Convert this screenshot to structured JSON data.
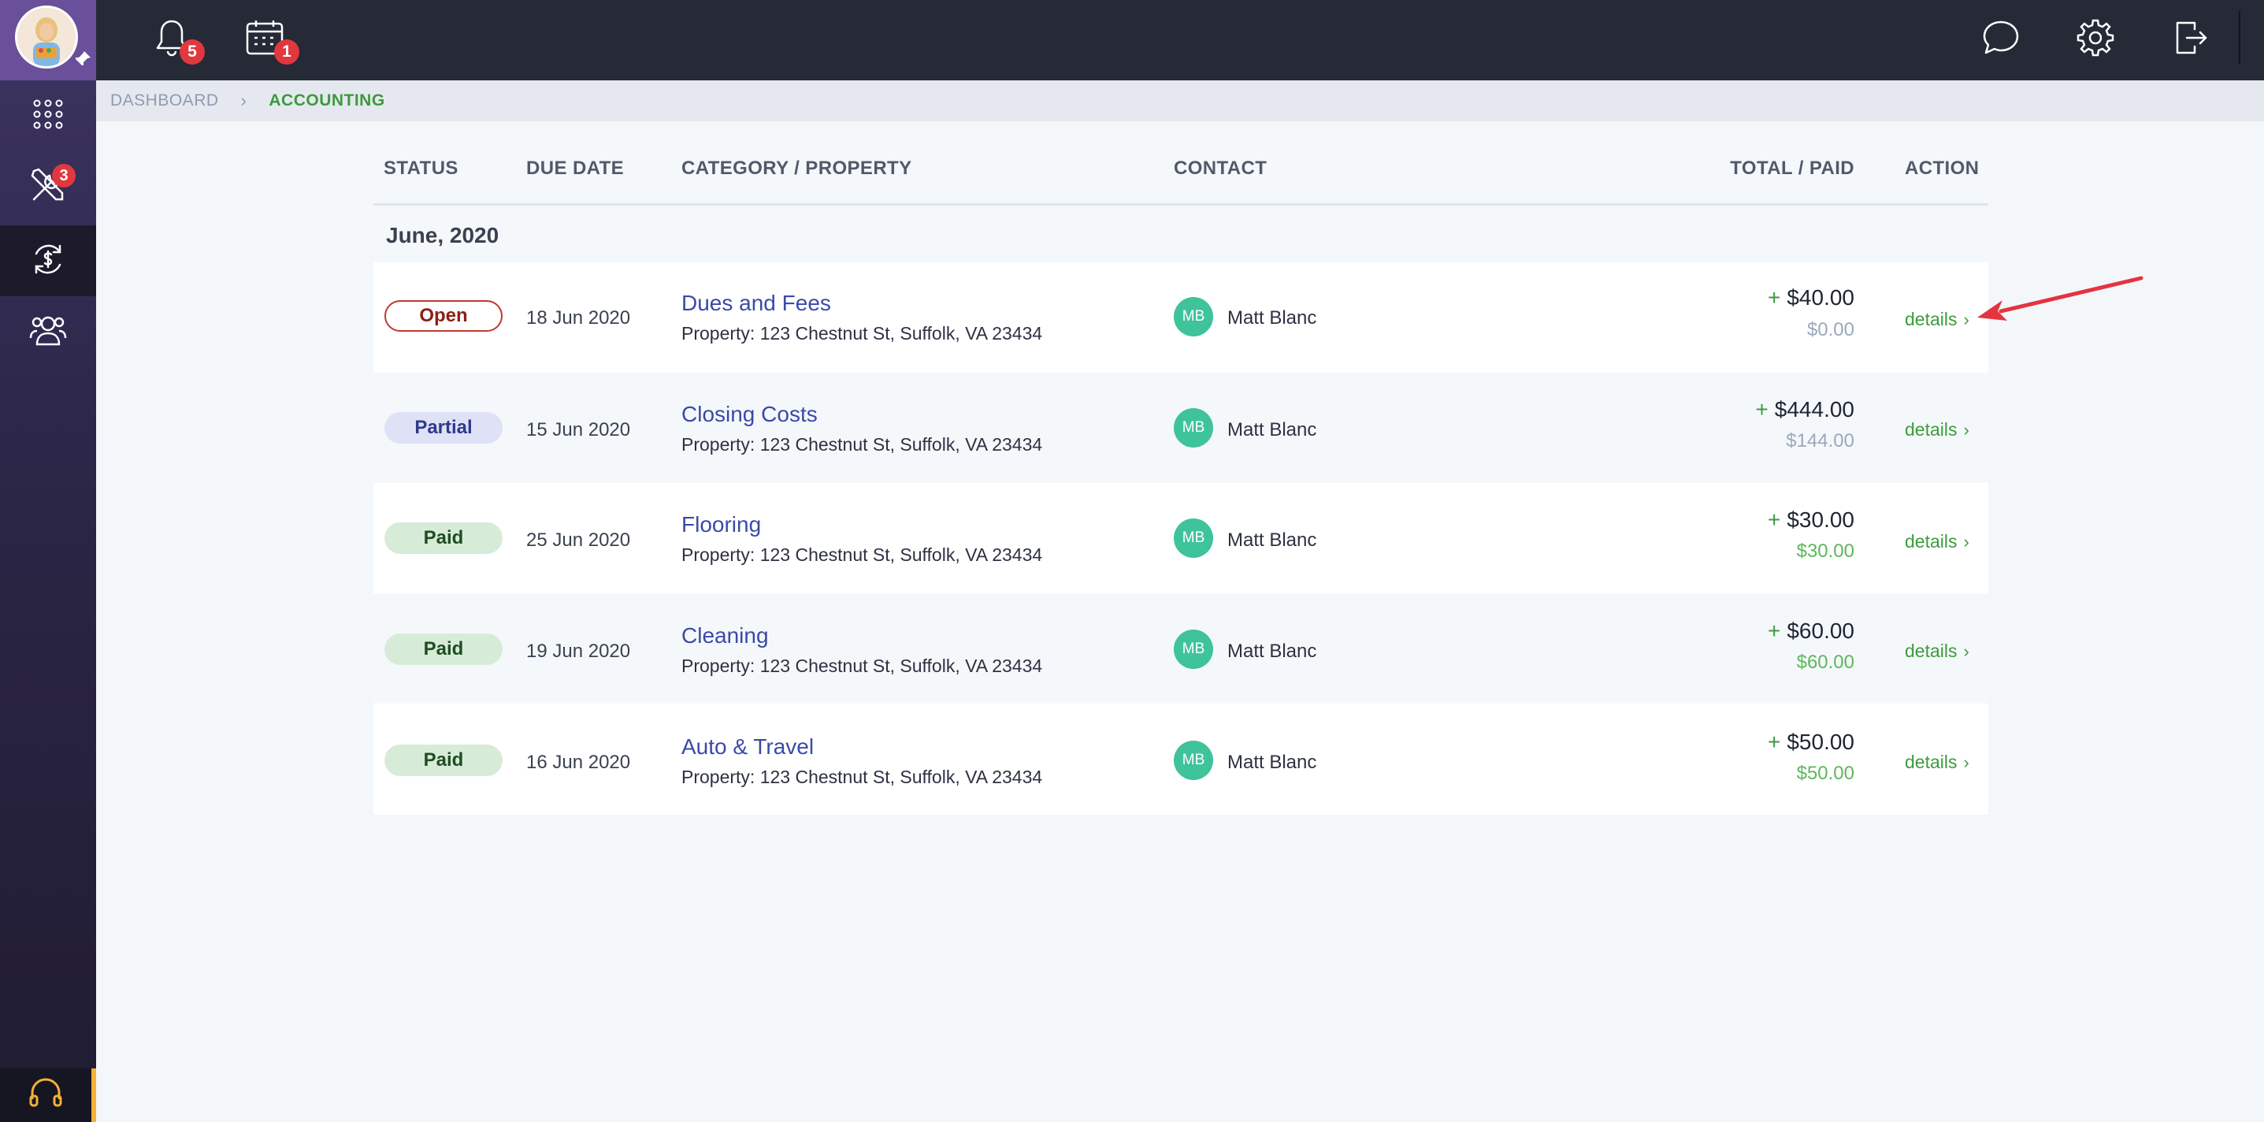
{
  "sidebar": {
    "tools_badge": "3"
  },
  "topbar": {
    "notifications_badge": "5",
    "calendar_badge": "1"
  },
  "breadcrumb": {
    "root": "DASHBOARD",
    "current": "ACCOUNTING"
  },
  "table": {
    "headers": {
      "status": "STATUS",
      "due_date": "DUE DATE",
      "category": "CATEGORY / PROPERTY",
      "contact": "CONTACT",
      "total": "TOTAL / PAID",
      "action": "ACTION"
    },
    "group_label": "June, 2020",
    "rows": [
      {
        "status": "Open",
        "due": "18 Jun 2020",
        "category": "Dues and Fees",
        "property": "Property: 123 Chestnut St, Suffolk, VA 23434",
        "contact_initials": "MB",
        "contact_name": "Matt Blanc",
        "total": "$40.00",
        "paid": "$0.00",
        "action": "details"
      },
      {
        "status": "Partial",
        "due": "15 Jun 2020",
        "category": "Closing Costs",
        "property": "Property: 123 Chestnut St, Suffolk, VA 23434",
        "contact_initials": "MB",
        "contact_name": "Matt Blanc",
        "total": "$444.00",
        "paid": "$144.00",
        "action": "details"
      },
      {
        "status": "Paid",
        "due": "25 Jun 2020",
        "category": "Flooring",
        "property": "Property: 123 Chestnut St, Suffolk, VA 23434",
        "contact_initials": "MB",
        "contact_name": "Matt Blanc",
        "total": "$30.00",
        "paid": "$30.00",
        "action": "details"
      },
      {
        "status": "Paid",
        "due": "19 Jun 2020",
        "category": "Cleaning",
        "property": "Property: 123 Chestnut St, Suffolk, VA 23434",
        "contact_initials": "MB",
        "contact_name": "Matt Blanc",
        "total": "$60.00",
        "paid": "$60.00",
        "action": "details"
      },
      {
        "status": "Paid",
        "due": "16 Jun 2020",
        "category": "Auto & Travel",
        "property": "Property: 123 Chestnut St, Suffolk, VA 23434",
        "contact_initials": "MB",
        "contact_name": "Matt Blanc",
        "total": "$50.00",
        "paid": "$50.00",
        "action": "details"
      }
    ]
  },
  "colors": {
    "accent_green": "#3d9a3d",
    "link_blue": "#3a4aa8",
    "badge_red": "#e0383e",
    "annotation_red": "#e5333f"
  },
  "icons": {
    "sidebar": [
      "user-avatar",
      "pin-icon",
      "apps-grid-icon",
      "tools-icon",
      "dollar-cycle-icon",
      "users-icon",
      "headset-icon"
    ],
    "topbar": [
      "bell-icon",
      "calendar-icon",
      "chat-icon",
      "gear-icon",
      "logout-icon"
    ]
  }
}
